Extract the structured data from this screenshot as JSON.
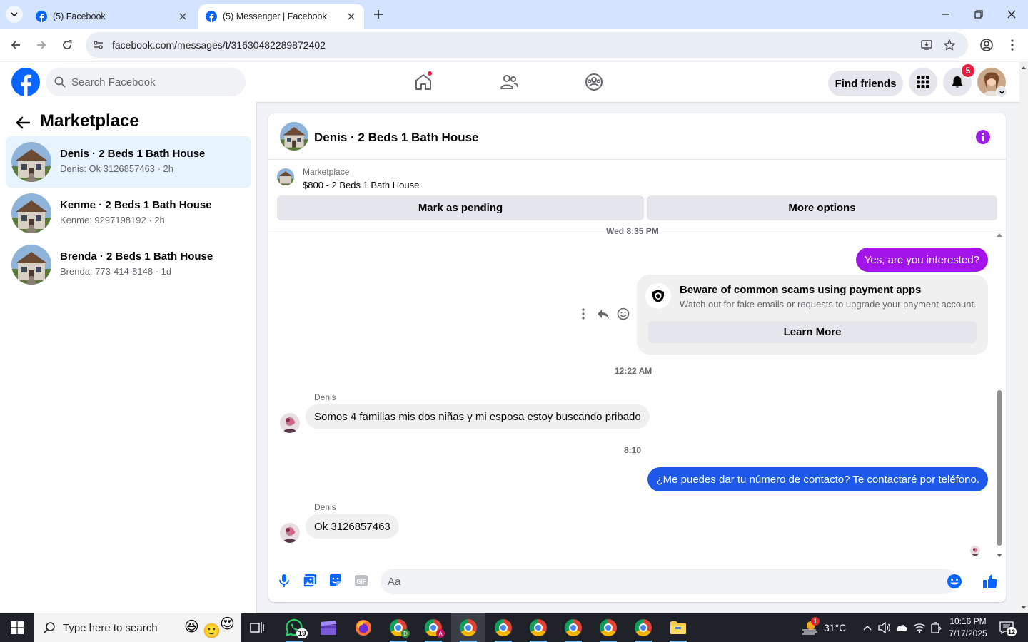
{
  "browser": {
    "tabs": [
      {
        "title": "(5) Facebook",
        "active": false
      },
      {
        "title": "(5) Messenger | Facebook",
        "active": true
      }
    ],
    "url": "facebook.com/messages/t/31630482289872402"
  },
  "fb_header": {
    "search_placeholder": "Search Facebook",
    "find_friends_label": "Find friends",
    "notification_count": "5",
    "brand_color": "#0866ff"
  },
  "left_pane": {
    "title": "Marketplace",
    "conversations": [
      {
        "name": "Denis · 2 Beds 1 Bath House",
        "preview": "Denis: Ok 3126857463 · 2h",
        "selected": true
      },
      {
        "name": "Kenme · 2 Beds 1 Bath House",
        "preview": "Kenme: 9297198192 · 2h",
        "selected": false
      },
      {
        "name": "Brenda · 2 Beds 1 Bath House",
        "preview": "Brenda: 773-414-8148 · 1d",
        "selected": false
      }
    ]
  },
  "chat": {
    "title": "Denis · 2 Beds 1 Bath House",
    "listing": {
      "category": "Marketplace",
      "title": "$800 - 2 Beds 1 Bath House",
      "mark_pending_label": "Mark as pending",
      "more_options_label": "More options"
    },
    "messages": {
      "stamp1": "Wed 8:35 PM",
      "out1": "Yes, are you interested?",
      "scam_title": "Beware of common scams using payment apps",
      "scam_desc": "Watch out for fake emails or requests to upgrade your payment account.",
      "scam_button": "Learn More",
      "stamp2": "12:22 AM",
      "sender1": "Denis",
      "in1": "Somos 4 familias mis dos niñas y mi esposa estoy buscando pribado",
      "stamp3": "8:10",
      "out2": "¿Me puedes dar tu número de contacto? Te contactaré por teléfono.",
      "sender2": "Denis",
      "in2": "Ok 3126857463"
    },
    "composer_placeholder": "Aa",
    "colors": {
      "outgoing_purple": "#a214ea",
      "outgoing_blue": "#1e58e8",
      "accent": "#9b1ee6"
    }
  },
  "taskbar": {
    "search_placeholder": "Type here to search",
    "whatsapp_badge": "19",
    "weather": "31°C",
    "weather_badge": "1",
    "time": "10:16 PM",
    "date": "7/17/2025",
    "notifications_count": "12"
  }
}
